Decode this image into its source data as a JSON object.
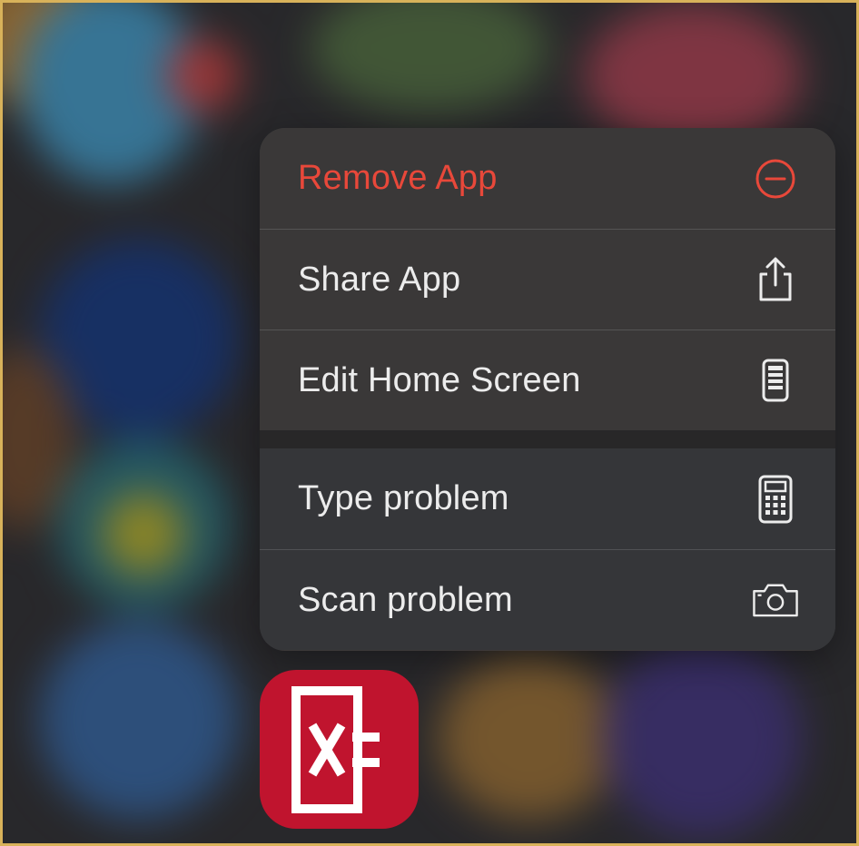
{
  "menu": {
    "items": [
      {
        "label": "Remove App",
        "icon": "minus-circle-icon",
        "style": "destructive"
      },
      {
        "label": "Share App",
        "icon": "share-icon"
      },
      {
        "label": "Edit Home Screen",
        "icon": "phone-icon"
      }
    ],
    "app_items": [
      {
        "label": "Type problem",
        "icon": "calculator-icon"
      },
      {
        "label": "Scan problem",
        "icon": "camera-icon"
      }
    ]
  },
  "app": {
    "icon": "photomath-icon",
    "color": "#c0142e"
  },
  "colors": {
    "destructive": "#e8483a",
    "menu_text": "#ececec"
  }
}
